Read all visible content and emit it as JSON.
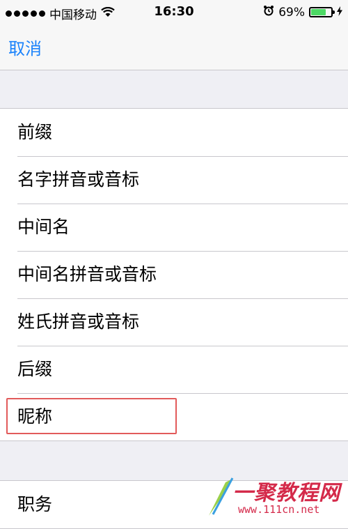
{
  "status_bar": {
    "carrier": "中国移动",
    "time": "16:30",
    "battery": "69%",
    "battery_level": 0.69,
    "icons": [
      "signal-dots-icon",
      "wifi-icon",
      "alarm-icon",
      "battery-icon",
      "charging-icon"
    ]
  },
  "nav": {
    "cancel_label": "取消"
  },
  "fields_group": {
    "items": [
      {
        "label": "前缀"
      },
      {
        "label": "名字拼音或音标"
      },
      {
        "label": "中间名"
      },
      {
        "label": "中间名拼音或音标"
      },
      {
        "label": "姓氏拼音或音标"
      },
      {
        "label": "后缀"
      },
      {
        "label": "昵称"
      }
    ]
  },
  "second_group": {
    "items": [
      {
        "label": "职务"
      }
    ]
  },
  "watermark": {
    "title": "一聚教程网",
    "url": "www.111cn.net"
  },
  "colors": {
    "accent": "#1a82fb",
    "highlight_border": "#e25a5a",
    "background": "#efeff4",
    "battery": "#4cd964",
    "watermark": "#d42a4a"
  }
}
